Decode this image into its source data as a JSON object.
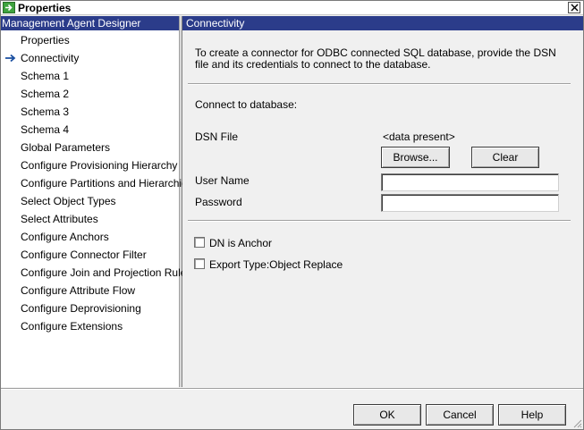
{
  "window": {
    "title": "Properties",
    "app_icon": "green-arrow-icon",
    "close_icon": "close-icon"
  },
  "designer": {
    "header": "Management Agent Designer",
    "current_marker_icon": "blue-arrow-icon",
    "items": [
      {
        "label": "Properties",
        "current": false
      },
      {
        "label": "Connectivity",
        "current": true
      },
      {
        "label": "Schema 1",
        "current": false
      },
      {
        "label": "Schema 2",
        "current": false
      },
      {
        "label": "Schema 3",
        "current": false
      },
      {
        "label": "Schema 4",
        "current": false
      },
      {
        "label": "Global Parameters",
        "current": false
      },
      {
        "label": "Configure Provisioning Hierarchy",
        "current": false
      },
      {
        "label": "Configure Partitions and Hierarchies",
        "current": false
      },
      {
        "label": "Select Object Types",
        "current": false
      },
      {
        "label": "Select Attributes",
        "current": false
      },
      {
        "label": "Configure Anchors",
        "current": false
      },
      {
        "label": "Configure Connector Filter",
        "current": false
      },
      {
        "label": "Configure Join and Projection Rules",
        "current": false
      },
      {
        "label": "Configure Attribute Flow",
        "current": false
      },
      {
        "label": "Configure Deprovisioning",
        "current": false
      },
      {
        "label": "Configure Extensions",
        "current": false
      }
    ]
  },
  "connectivity": {
    "header": "Connectivity",
    "intro": "To create a connector for ODBC connected SQL database, provide the DSN file and its credentials to connect to the database.",
    "connect_label": "Connect to database:",
    "dsn_label": "DSN File",
    "dsn_value": "<data present>",
    "browse_label": "Browse...",
    "clear_label": "Clear",
    "username_label": "User Name",
    "username_value": "",
    "password_label": "Password",
    "password_value": "",
    "dn_anchor_label": "DN is Anchor",
    "dn_anchor_checked": false,
    "export_type_label": "Export Type:Object Replace",
    "export_type_checked": false
  },
  "footer": {
    "ok_label": "OK",
    "cancel_label": "Cancel",
    "help_label": "Help"
  },
  "colors": {
    "header_bg": "#2b3c8a",
    "header_text": "#ffffff",
    "arrow": "#1a4fa0"
  }
}
